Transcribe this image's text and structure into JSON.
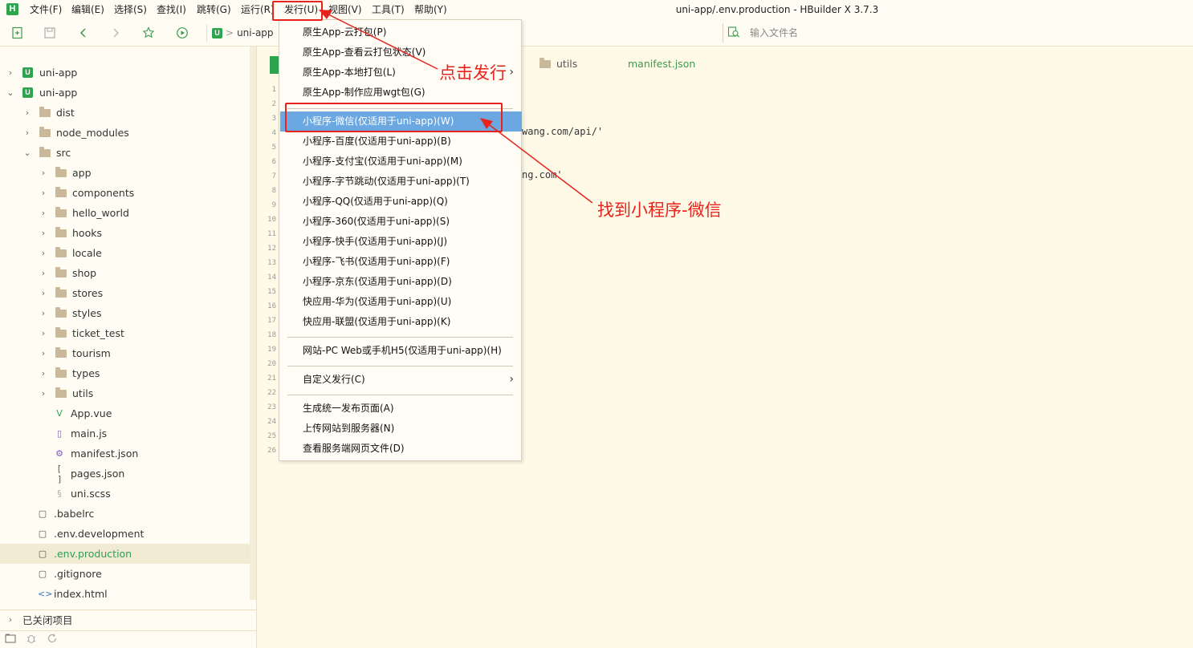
{
  "window": {
    "title": "uni-app/.env.production - HBuilder X 3.7.3"
  },
  "menubar": {
    "logo": "H",
    "items": [
      "文件(F)",
      "编辑(E)",
      "选择(S)",
      "查找(I)",
      "跳转(G)",
      "运行(R)",
      "发行(U)",
      "视图(V)",
      "工具(T)",
      "帮助(Y)"
    ]
  },
  "toolbar": {
    "project_badge": "U",
    "crumb_sep": ">",
    "project_name": "uni-app",
    "search_placeholder": "输入文件名"
  },
  "sidebar": {
    "tree": [
      {
        "label": "uni-app",
        "kind": "project",
        "expanded": false
      },
      {
        "label": "uni-app",
        "kind": "project",
        "expanded": true
      },
      {
        "label": "dist",
        "kind": "folder"
      },
      {
        "label": "node_modules",
        "kind": "folder"
      },
      {
        "label": "src",
        "kind": "folder",
        "expanded": true
      },
      {
        "label": "app",
        "kind": "folder"
      },
      {
        "label": "components",
        "kind": "folder"
      },
      {
        "label": "hello_world",
        "kind": "folder"
      },
      {
        "label": "hooks",
        "kind": "folder"
      },
      {
        "label": "locale",
        "kind": "folder"
      },
      {
        "label": "shop",
        "kind": "folder"
      },
      {
        "label": "stores",
        "kind": "folder"
      },
      {
        "label": "styles",
        "kind": "folder"
      },
      {
        "label": "ticket_test",
        "kind": "folder"
      },
      {
        "label": "tourism",
        "kind": "folder"
      },
      {
        "label": "types",
        "kind": "folder"
      },
      {
        "label": "utils",
        "kind": "folder"
      },
      {
        "label": "App.vue",
        "kind": "file",
        "icon": "vue-file-icon"
      },
      {
        "label": "main.js",
        "kind": "file",
        "icon": "js-file-icon"
      },
      {
        "label": "manifest.json",
        "kind": "file",
        "icon": "settings-file-icon"
      },
      {
        "label": "pages.json",
        "kind": "file",
        "icon": "json-file-icon"
      },
      {
        "label": "uni.scss",
        "kind": "file",
        "icon": "style-file-icon"
      },
      {
        "label": ".babelrc",
        "kind": "file",
        "icon": "text-file-icon"
      },
      {
        "label": ".env.development",
        "kind": "file",
        "icon": "text-file-icon"
      },
      {
        "label": ".env.production",
        "kind": "file",
        "icon": "text-file-icon",
        "selected": true
      },
      {
        "label": ".gitignore",
        "kind": "file",
        "icon": "text-file-icon"
      },
      {
        "label": "index.html",
        "kind": "file",
        "icon": "html-file-icon"
      }
    ],
    "closed_projects_label": "已关闭项目"
  },
  "editor": {
    "tabs": {
      "utils": "utils",
      "manifest": "manifest.json"
    },
    "line_numbers": [
      "1",
      "2",
      "3",
      "4",
      "5",
      "6",
      "7",
      "8",
      "9",
      "10",
      "11",
      "12",
      "13",
      "14",
      "15",
      "16",
      "17",
      "18",
      "19",
      "20",
      "21",
      "22",
      "23",
      "24",
      "25",
      "26"
    ],
    "code_fragments": {
      "line4": "wang.com/api/'",
      "line6": "ng.com'"
    }
  },
  "publish_menu": {
    "items": [
      {
        "label": "原生App-云打包(P)"
      },
      {
        "label": "原生App-查看云打包状态(V)"
      },
      {
        "label": "原生App-本地打包(L)",
        "submenu": true
      },
      {
        "label": "原生App-制作应用wgt包(G)"
      },
      {
        "label": "小程序-微信(仅适用于uni-app)(W)",
        "highlighted": true
      },
      {
        "label": "小程序-百度(仅适用于uni-app)(B)"
      },
      {
        "label": "小程序-支付宝(仅适用于uni-app)(M)"
      },
      {
        "label": "小程序-字节跳动(仅适用于uni-app)(T)"
      },
      {
        "label": "小程序-QQ(仅适用于uni-app)(Q)"
      },
      {
        "label": "小程序-360(仅适用于uni-app)(S)"
      },
      {
        "label": "小程序-快手(仅适用于uni-app)(J)"
      },
      {
        "label": "小程序-飞书(仅适用于uni-app)(F)"
      },
      {
        "label": "小程序-京东(仅适用于uni-app)(D)"
      },
      {
        "label": "快应用-华为(仅适用于uni-app)(U)"
      },
      {
        "label": "快应用-联盟(仅适用于uni-app)(K)"
      },
      {
        "label": "网站-PC Web或手机H5(仅适用于uni-app)(H)"
      },
      {
        "label": "自定义发行(C)",
        "submenu": true
      },
      {
        "label": "生成统一发布页面(A)"
      },
      {
        "label": "上传网站到服务器(N)"
      },
      {
        "label": "查看服务端网页文件(D)"
      }
    ]
  },
  "annotations": {
    "click_publish": "点击发行",
    "find_wechat": "找到小程序-微信",
    "color": "#e8231c"
  },
  "colors": {
    "accent_green": "#2ea44f",
    "highlight_blue": "#6ba7e0",
    "background": "#fffae8"
  }
}
